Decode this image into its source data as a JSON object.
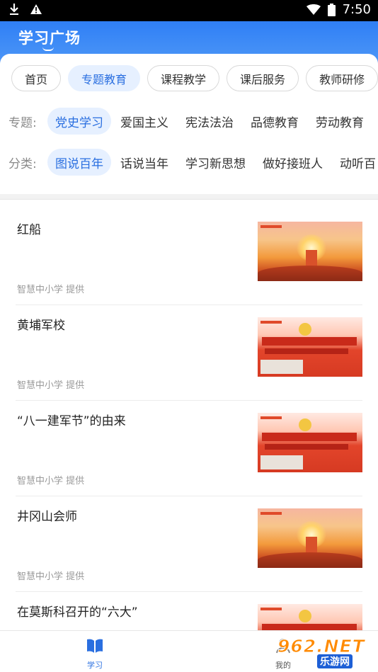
{
  "status_bar": {
    "time": "7:50"
  },
  "app": {
    "title": "学习广场"
  },
  "tabs": [
    {
      "label": "首页",
      "active": false
    },
    {
      "label": "专题教育",
      "active": true
    },
    {
      "label": "课程教学",
      "active": false
    },
    {
      "label": "课后服务",
      "active": false
    },
    {
      "label": "教师研修",
      "active": false
    }
  ],
  "topic_filter": {
    "label": "专题:",
    "options": [
      "党史学习",
      "爱国主义",
      "宪法法治",
      "品德教育",
      "劳动教育"
    ],
    "selected": "党史学习"
  },
  "category_filter": {
    "label": "分类:",
    "options": [
      "图说百年",
      "话说当年",
      "学习新思想",
      "做好接班人",
      "动听百"
    ],
    "selected": "图说百年"
  },
  "list": [
    {
      "title": "红船",
      "provider": "智慧中小学 提供"
    },
    {
      "title": "黄埔军校",
      "provider": "智慧中小学 提供"
    },
    {
      "title": "“八一建军节”的由来",
      "provider": "智慧中小学 提供"
    },
    {
      "title": "井冈山会师",
      "provider": "智慧中小学 提供"
    },
    {
      "title": "在莫斯科召开的“六大”",
      "provider": ""
    }
  ],
  "bottom_nav": {
    "items": [
      {
        "label": "学习",
        "active": true
      },
      {
        "label": "我的",
        "active": false
      }
    ]
  },
  "watermark": {
    "main": "962.NET",
    "sub": "乐游网"
  },
  "colors": {
    "accent": "#2a6fe0",
    "header": "#3a86f0",
    "chip_active_bg": "#e6f0ff"
  }
}
